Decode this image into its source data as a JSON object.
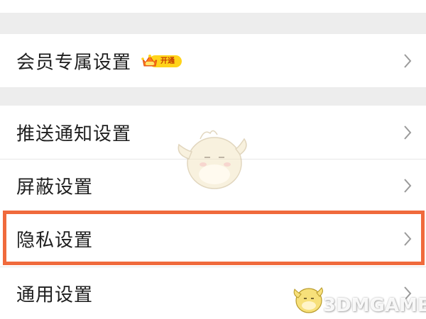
{
  "settings": {
    "items": [
      {
        "label": "会员专属设置",
        "badge": "开通"
      },
      {
        "label": "推送通知设置"
      },
      {
        "label": "屏蔽设置"
      },
      {
        "label": "隐私设置",
        "highlighted": true
      },
      {
        "label": "通用设置"
      }
    ]
  },
  "watermark": {
    "text": "3DMGAME"
  },
  "colors": {
    "separator": "#ededed",
    "highlight": "#f06a3c",
    "badge": "#ffd31a",
    "chevron": "#9a9a9a"
  }
}
